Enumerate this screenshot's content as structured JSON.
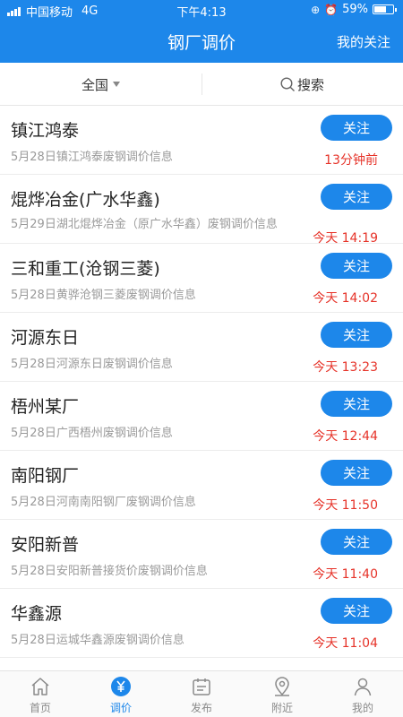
{
  "status": {
    "carrier": "中国移动",
    "network": "4G",
    "time": "下午4:13",
    "battery": "59%",
    "battery_level": 0.59
  },
  "header": {
    "title": "钢厂调价",
    "right_action": "我的关注"
  },
  "filter": {
    "region": "全国",
    "search": "搜索"
  },
  "follow_label": "关注",
  "items": [
    {
      "title": "镇江鸿泰",
      "desc": "5月28日镇江鸿泰废钢调价信息",
      "time": "13分钟前"
    },
    {
      "title": "焜烨冶金(广水华鑫)",
      "desc": "5月29日湖北焜烨冶金（原广水华鑫）废钢调价信息",
      "time": "今天  14:19"
    },
    {
      "title": "三和重工(沧钢三菱)",
      "desc": "5月28日黄骅沧钢三菱废钢调价信息",
      "time": "今天  14:02"
    },
    {
      "title": "河源东日",
      "desc": "5月28日河源东日废钢调价信息",
      "time": "今天  13:23"
    },
    {
      "title": "梧州某厂",
      "desc": "5月28日广西梧州废钢调价信息",
      "time": "今天  12:44"
    },
    {
      "title": "南阳钢厂",
      "desc": "5月28日河南南阳钢厂废钢调价信息",
      "time": "今天  11:50"
    },
    {
      "title": "安阳新普",
      "desc": "5月28日安阳新普接货价废钢调价信息",
      "time": "今天  11:40"
    },
    {
      "title": "华鑫源",
      "desc": "5月28日运城华鑫源废钢调价信息",
      "time": "今天  11:04"
    }
  ],
  "tabs": [
    {
      "label": "首页",
      "icon": "home-icon"
    },
    {
      "label": "调价",
      "icon": "yuan-icon",
      "active": true
    },
    {
      "label": "发布",
      "icon": "publish-icon"
    },
    {
      "label": "附近",
      "icon": "location-icon"
    },
    {
      "label": "我的",
      "icon": "user-icon"
    }
  ],
  "colors": {
    "primary": "#1d87ea",
    "time_red": "#e63329",
    "desc_gray": "#9a9a9a"
  }
}
